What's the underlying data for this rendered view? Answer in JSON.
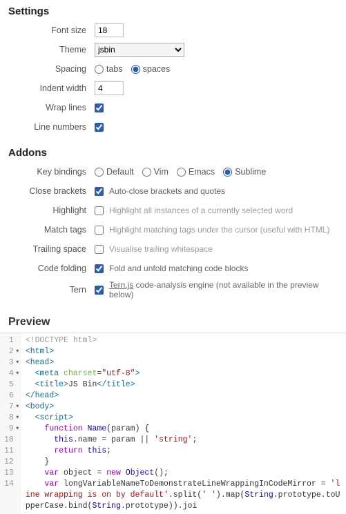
{
  "settings": {
    "title": "Settings",
    "font_size_label": "Font size",
    "font_size_value": "18",
    "theme_label": "Theme",
    "theme_value": "jsbin",
    "spacing_label": "Spacing",
    "spacing_tabs": "tabs",
    "spacing_spaces": "spaces",
    "spacing_selected": "spaces",
    "indent_label": "Indent width",
    "indent_value": "4",
    "wrap_label": "Wrap lines",
    "wrap_checked": true,
    "linenum_label": "Line numbers",
    "linenum_checked": true
  },
  "addons": {
    "title": "Addons",
    "keybindings": {
      "label": "Key bindings",
      "options": [
        "Default",
        "Vim",
        "Emacs",
        "Sublime"
      ],
      "selected": "Sublime"
    },
    "close_brackets": {
      "label": "Close brackets",
      "desc": "Auto-close brackets and quotes",
      "checked": true
    },
    "highlight": {
      "label": "Highlight",
      "desc": "Highlight all instances of a currently selected word",
      "checked": false
    },
    "match_tags": {
      "label": "Match tags",
      "desc": "Highlight matching tags under the cursor (useful with HTML)",
      "checked": false
    },
    "trailing": {
      "label": "Trailing space",
      "desc": "Visualise trailing whitespace",
      "checked": false
    },
    "folding": {
      "label": "Code folding",
      "desc": "Fold and unfold matching code blocks",
      "checked": true
    },
    "tern": {
      "label": "Tern",
      "link": "Tern.js",
      "desc": " code-analysis engine (not available in the preview below)",
      "checked": true
    }
  },
  "preview": {
    "title": "Preview",
    "lines": [
      1,
      2,
      3,
      4,
      5,
      6,
      7,
      8,
      9,
      10,
      11,
      12,
      13,
      14
    ]
  }
}
